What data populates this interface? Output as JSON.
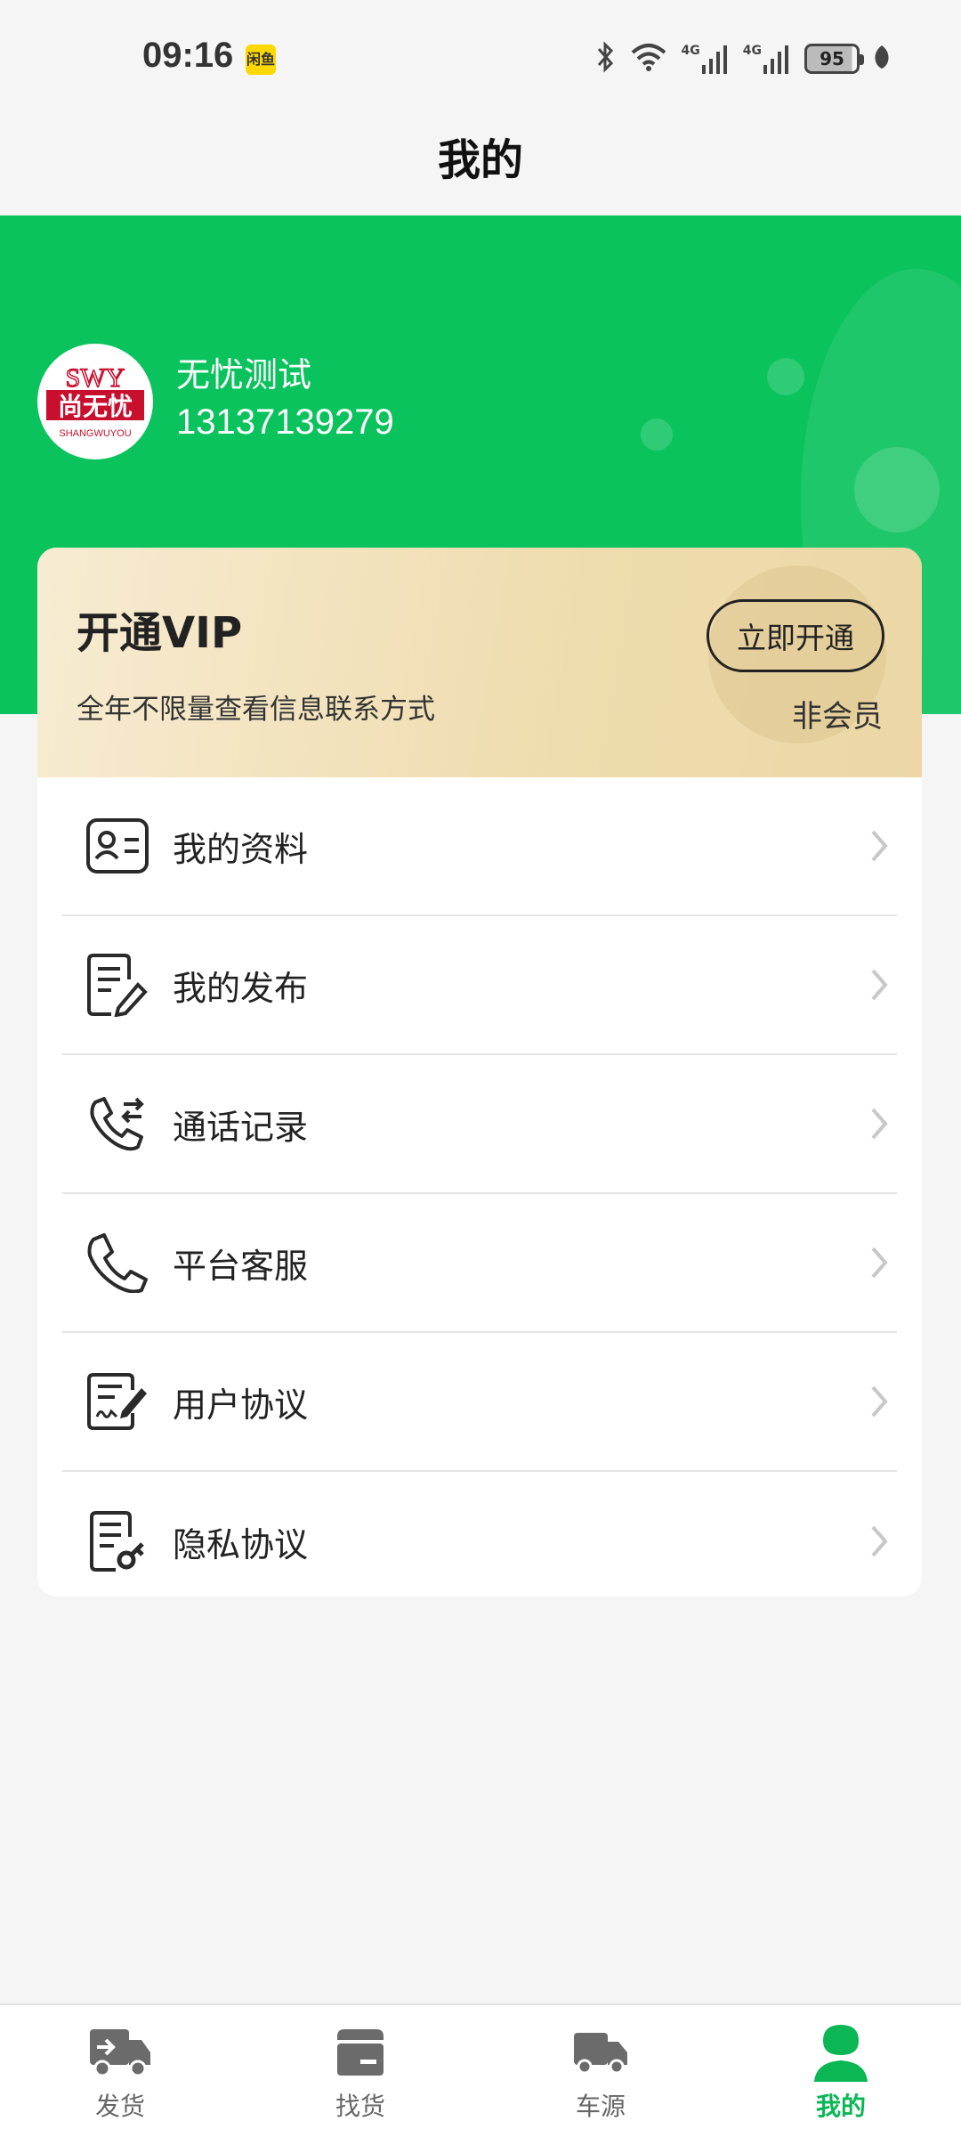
{
  "status_bar": {
    "time": "09:16",
    "app_badge": "闲鱼",
    "battery": "95",
    "network_1": "4G",
    "network_2": "4G"
  },
  "header": {
    "title": "我的"
  },
  "user": {
    "name": "无忧测试",
    "phone": "13137139279",
    "avatar_text_top": "SWY",
    "avatar_text_main": "尚无忧",
    "avatar_text_bottom": "SHANGWUYOU"
  },
  "vip": {
    "title": "开通VIP",
    "description": "全年不限量查看信息联系方式",
    "button_label": "立即开通",
    "status": "非会员"
  },
  "menu": {
    "items": [
      {
        "label": "我的资料",
        "icon": "profile-card-icon"
      },
      {
        "label": "我的发布",
        "icon": "edit-document-icon"
      },
      {
        "label": "通话记录",
        "icon": "call-history-icon"
      },
      {
        "label": "平台客服",
        "icon": "phone-icon"
      },
      {
        "label": "用户协议",
        "icon": "agreement-icon"
      },
      {
        "label": "隐私协议",
        "icon": "privacy-icon"
      }
    ]
  },
  "bottom_nav": {
    "items": [
      {
        "label": "发货",
        "icon": "shipping-truck-icon",
        "active": false
      },
      {
        "label": "找货",
        "icon": "box-icon",
        "active": false
      },
      {
        "label": "车源",
        "icon": "truck-icon",
        "active": false
      },
      {
        "label": "我的",
        "icon": "user-icon",
        "active": true
      }
    ]
  },
  "colors": {
    "brand_green": "#0bc35d",
    "active_nav": "#0bb655"
  }
}
